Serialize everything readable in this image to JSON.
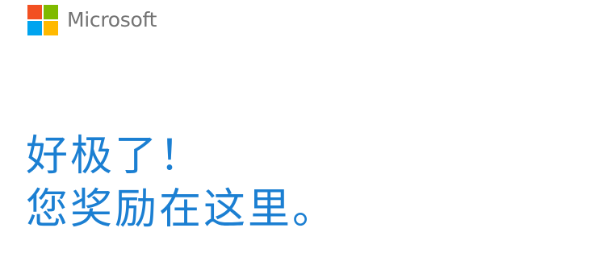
{
  "brand": {
    "name": "Microsoft",
    "logo_colors": [
      "#f25022",
      "#7fba00",
      "#00a4ef",
      "#ffb900"
    ]
  },
  "headline": {
    "line1": "好极了！",
    "line2": "您奖励在这里。"
  },
  "colors": {
    "accent": "#1b7fd2",
    "brand_text": "#737373"
  }
}
